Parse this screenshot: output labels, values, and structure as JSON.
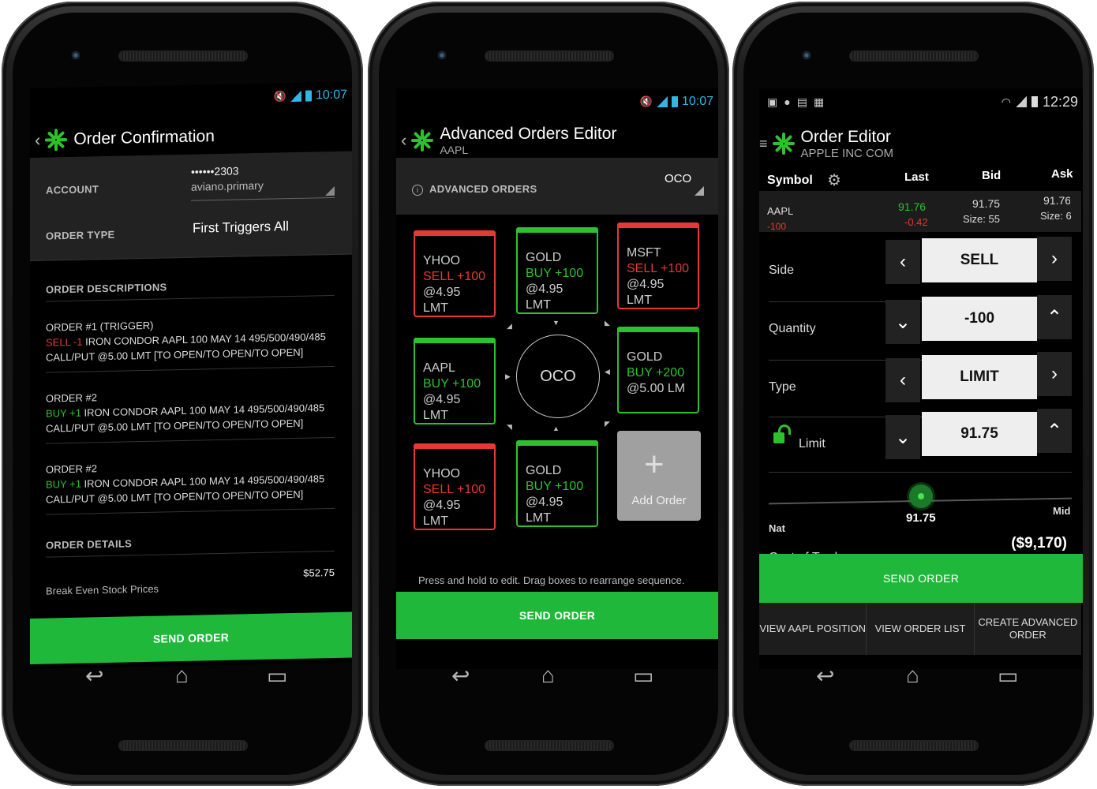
{
  "status_1": {
    "time": "10:07"
  },
  "status_2": {
    "time": "10:07"
  },
  "status_3": {
    "time": "12:29"
  },
  "screen1": {
    "title": "Order Confirmation",
    "account_label": "ACCOUNT",
    "account_number": "••••••2303",
    "account_name": "aviano.primary",
    "order_type_label": "ORDER TYPE",
    "order_type_value": "First Triggers All",
    "order_descriptions_label": "ORDER DESCRIPTIONS",
    "orders": [
      {
        "header": "ORDER #1 (TRIGGER)",
        "action": "SELL -1",
        "action_color": "#e53935",
        "line1_rest": " IRON CONDOR AAPL 100 MAY 14 495/500/490/485",
        "line2": "CALL/PUT @5.00 LMT [TO OPEN/TO OPEN/TO OPEN]"
      },
      {
        "header": "ORDER #2",
        "action": "BUY +1",
        "action_color": "#2ec12e",
        "line1_rest": " IRON CONDOR AAPL 100 MAY 14 495/500/490/485",
        "line2": "CALL/PUT @5.00 LMT [TO OPEN/TO OPEN/TO OPEN]"
      },
      {
        "header": "ORDER #2",
        "action": "BUY +1",
        "action_color": "#2ec12e",
        "line1_rest": " IRON CONDOR AAPL 100 MAY 14 495/500/490/485",
        "line2": "CALL/PUT @5.00 LMT [TO OPEN/TO OPEN/TO OPEN]"
      }
    ],
    "order_details_label": "ORDER DETAILS",
    "break_even_label": "Break Even Stock Prices",
    "break_even_value": "$52.75",
    "send_label": "SEND ORDER"
  },
  "screen2": {
    "title": "Advanced Orders Editor",
    "subtitle": "AAPL",
    "section_label": "ADVANCED ORDERS",
    "mode_value": "OCO",
    "cards": [
      {
        "symbol": "YHOO",
        "action": "SELL +100",
        "price": "@4.95 LMT",
        "color": "red"
      },
      {
        "symbol": "GOLD",
        "action": "BUY +100",
        "price": "@4.95 LMT",
        "color": "green"
      },
      {
        "symbol": "MSFT",
        "action": "SELL +100",
        "price": "@4.95 LMT",
        "color": "red"
      },
      {
        "symbol": "AAPL",
        "action": "BUY +100",
        "price": "@4.95 LMT",
        "color": "green"
      },
      {
        "symbol": "GOLD",
        "action": "BUY +200",
        "price": "@5.00 LM",
        "color": "green"
      },
      {
        "symbol": "YHOO",
        "action": "SELL +100",
        "price": "@4.95 LMT",
        "color": "red"
      },
      {
        "symbol": "GOLD",
        "action": "BUY +100",
        "price": "@4.95 LMT",
        "color": "green"
      }
    ],
    "center_label": "OCO",
    "add_order_label": "Add Order",
    "hint": "Press and hold to edit.  Drag boxes to rearrange sequence.",
    "send_label": "SEND ORDER"
  },
  "screen3": {
    "title": "Order Editor",
    "subtitle": "APPLE INC COM",
    "headers": {
      "symbol": "Symbol",
      "last": "Last",
      "bid": "Bid",
      "ask": "Ask"
    },
    "quote": {
      "symbol": "AAPL",
      "qty": "-100",
      "last": "91.76",
      "change": "-0.42",
      "bid": "91.75",
      "bid_size": "Size: 55",
      "ask": "91.76",
      "ask_size": "Size: 6"
    },
    "side_label": "Side",
    "side_value": "SELL",
    "quantity_label": "Quantity",
    "quantity_value": "-100",
    "type_label": "Type",
    "type_value": "LIMIT",
    "limit_label": "Limit",
    "limit_value": "91.75",
    "slider_value": "91.75",
    "slider_left": "Nat",
    "slider_right": "Mid",
    "cost_label": "Cost of Trade",
    "cost_value": "($9,170)",
    "send_label": "SEND ORDER",
    "bottom_1": "VIEW AAPL POSITION",
    "bottom_2": "VIEW ORDER LIST",
    "bottom_3": "CREATE ADVANCED ORDER"
  },
  "colors": {
    "accent_green": "#20b83a",
    "sell_red": "#e53935",
    "status_blue": "#33b5e5"
  }
}
